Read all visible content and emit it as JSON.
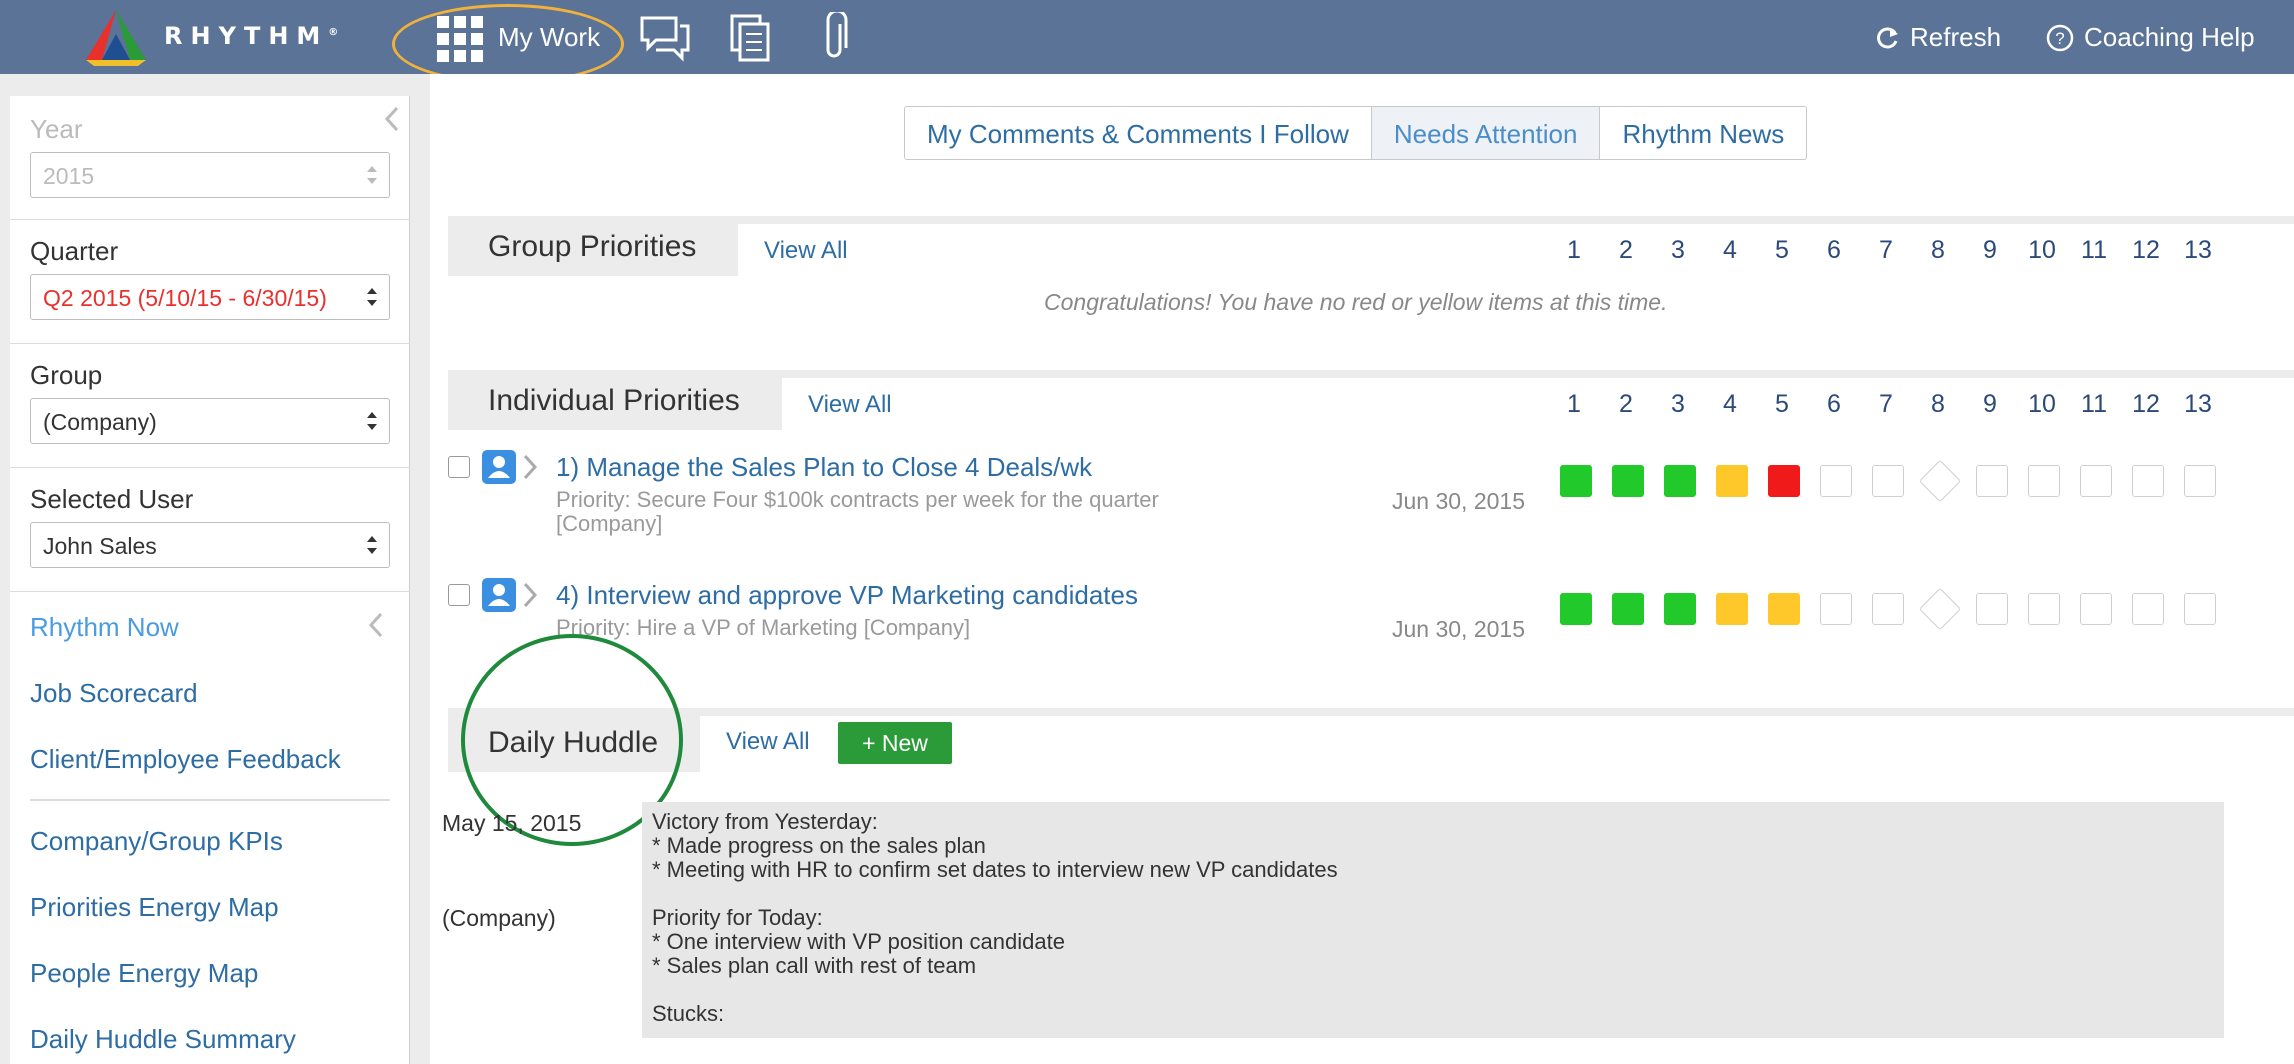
{
  "app": {
    "brand": "RHYTHM",
    "brand_mark": "®"
  },
  "topbar": {
    "my_work_label": "My Work",
    "refresh_label": "Refresh",
    "coaching_help_label": "Coaching Help",
    "icons": [
      "apps-grid-icon",
      "chat-icon",
      "documents-icon",
      "paperclip-icon",
      "refresh-icon",
      "help-icon"
    ]
  },
  "sidebar": {
    "year": {
      "label": "Year",
      "value": "2015"
    },
    "quarter": {
      "label": "Quarter",
      "value": "Q2 2015 (5/10/15 - 6/30/15)"
    },
    "group": {
      "label": "Group",
      "value": "(Company)"
    },
    "selected_user": {
      "label": "Selected User",
      "value": "John Sales"
    },
    "links": [
      "Rhythm Now",
      "Job Scorecard",
      "Client/Employee Feedback"
    ],
    "links2": [
      "Company/Group KPIs",
      "Priorities Energy Map",
      "People Energy Map",
      "Daily Huddle Summary"
    ]
  },
  "tabs": [
    "My Comments & Comments I Follow",
    "Needs Attention",
    "Rhythm News"
  ],
  "weeks": [
    "1",
    "2",
    "3",
    "4",
    "5",
    "6",
    "7",
    "8",
    "9",
    "10",
    "11",
    "12",
    "13"
  ],
  "group_priorities": {
    "title": "Group Priorities",
    "view_all": "View All",
    "empty_message": "Congratulations! You have no red or yellow items at this time."
  },
  "individual_priorities": {
    "title": "Individual Priorities",
    "view_all": "View All",
    "items": [
      {
        "title": "1) Manage the Sales Plan to Close 4 Deals/wk",
        "subtitle": "Priority: Secure Four $100k contracts per week for the quarter [Company]",
        "date": "Jun 30, 2015",
        "weeks": [
          "green",
          "green",
          "green",
          "yellow",
          "red",
          "empty",
          "empty",
          "diamond",
          "empty",
          "empty",
          "empty",
          "empty",
          "empty"
        ]
      },
      {
        "title": "4) Interview and approve VP Marketing candidates",
        "subtitle": "Priority: Hire a VP of Marketing [Company]",
        "date": "Jun 30, 2015",
        "weeks": [
          "green",
          "green",
          "green",
          "yellow",
          "yellow",
          "empty",
          "empty",
          "diamond",
          "empty",
          "empty",
          "empty",
          "empty",
          "empty"
        ]
      }
    ]
  },
  "daily_huddle": {
    "title": "Daily Huddle",
    "view_all": "View All",
    "new_label": "+ New",
    "date": "May 15, 2015",
    "group": "(Company)",
    "note": "Victory from Yesterday:\n* Made progress on the sales plan\n* Meeting with HR to confirm set dates to interview new VP candidates\n\nPriority for Today:\n* One interview with VP position candidate\n* Sales plan call with rest of team\n\nStucks:"
  },
  "colors": {
    "topbar": "#5a7396",
    "link": "#2e6da4",
    "green": "#22c92a",
    "yellow": "#ffc82a",
    "red": "#f01a1a",
    "highlight_orange": "#f0b23c",
    "highlight_green": "#1f8a3c"
  }
}
